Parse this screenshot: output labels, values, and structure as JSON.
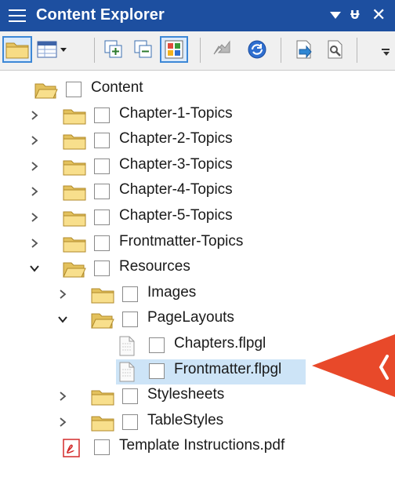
{
  "panel": {
    "title": "Content Explorer",
    "title_controls": [
      "dropdown-arrow-icon",
      "pin-icon",
      "close-icon"
    ]
  },
  "toolbar": {
    "buttons": [
      {
        "name": "show-folders-button",
        "icon": "folder-icon",
        "active": true
      },
      {
        "name": "view-layout-button",
        "icon": "grid-view-icon",
        "active": false
      },
      {
        "name": "expand-all-button",
        "icon": "expand-all-icon",
        "active": false
      },
      {
        "name": "collapse-all-button",
        "icon": "collapse-all-icon",
        "active": false
      },
      {
        "name": "show-file-types-button",
        "icon": "color-tiles-icon",
        "active": true
      },
      {
        "name": "arrow-action-button",
        "icon": "arrow-icon",
        "active": false
      },
      {
        "name": "refresh-button",
        "icon": "refresh-icon",
        "active": false
      },
      {
        "name": "send-button",
        "icon": "send-icon",
        "active": false
      },
      {
        "name": "find-button",
        "icon": "find-icon",
        "active": false
      }
    ]
  },
  "tree": {
    "items": [
      {
        "label": "Content",
        "type": "folder",
        "expand": "none",
        "level": 0
      },
      {
        "label": "Chapter-1-Topics",
        "type": "folder",
        "expand": "collapsed",
        "level": 1
      },
      {
        "label": "Chapter-2-Topics",
        "type": "folder",
        "expand": "collapsed",
        "level": 1
      },
      {
        "label": "Chapter-3-Topics",
        "type": "folder",
        "expand": "collapsed",
        "level": 1
      },
      {
        "label": "Chapter-4-Topics",
        "type": "folder",
        "expand": "collapsed",
        "level": 1
      },
      {
        "label": "Chapter-5-Topics",
        "type": "folder",
        "expand": "collapsed",
        "level": 1
      },
      {
        "label": "Frontmatter-Topics",
        "type": "folder",
        "expand": "collapsed",
        "level": 1
      },
      {
        "label": "Resources",
        "type": "folder-open",
        "expand": "expanded",
        "level": 1
      },
      {
        "label": "Images",
        "type": "folder",
        "expand": "collapsed",
        "level": 2
      },
      {
        "label": "PageLayouts",
        "type": "folder-open",
        "expand": "expanded",
        "level": 2
      },
      {
        "label": "Chapters.flpgl",
        "type": "file",
        "expand": "none",
        "level": 3
      },
      {
        "label": "Frontmatter.flpgl",
        "type": "file",
        "expand": "none",
        "level": 3,
        "selected": true
      },
      {
        "label": "Stylesheets",
        "type": "folder",
        "expand": "collapsed",
        "level": 2
      },
      {
        "label": "TableStyles",
        "type": "folder",
        "expand": "collapsed",
        "level": 2
      },
      {
        "label": "Template Instructions.pdf",
        "type": "pdf",
        "expand": "none",
        "level": 1
      }
    ]
  },
  "colors": {
    "titlebar": "#1d4fa0",
    "selection": "#cde4f7",
    "pointer": "#e8492a"
  }
}
